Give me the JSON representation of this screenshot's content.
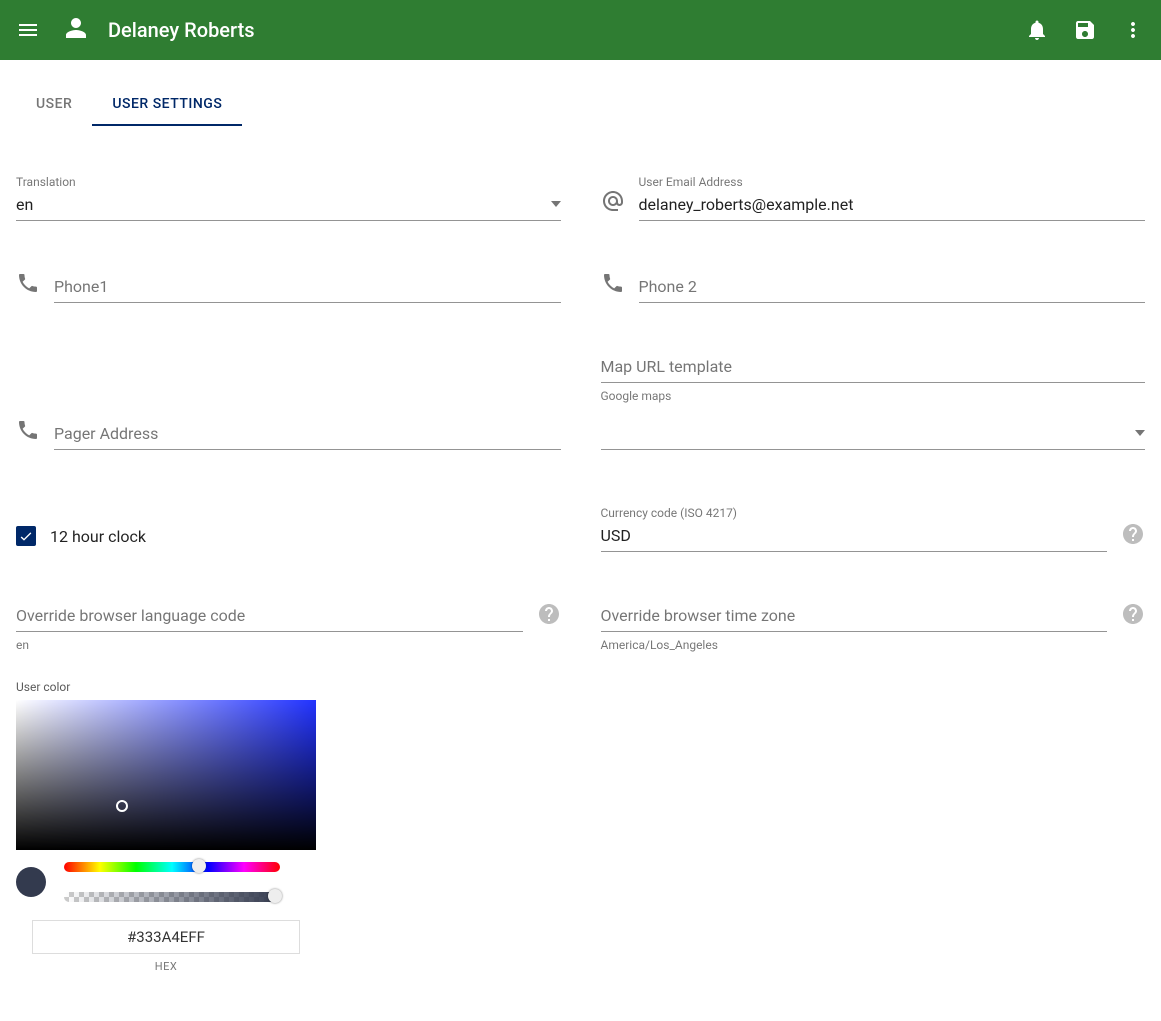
{
  "header": {
    "title": "Delaney Roberts"
  },
  "tabs": {
    "user": "USER",
    "user_settings": "USER SETTINGS"
  },
  "fields": {
    "translation": {
      "label": "Translation",
      "value": "en"
    },
    "email": {
      "label": "User Email Address",
      "value": "delaney_roberts@example.net"
    },
    "phone1": {
      "placeholder": "Phone1",
      "value": ""
    },
    "phone2": {
      "placeholder": "Phone 2",
      "value": ""
    },
    "pager": {
      "placeholder": "Pager Address",
      "value": ""
    },
    "mapurl": {
      "placeholder": "Map URL template",
      "value": "",
      "hint": "Google maps"
    },
    "mapurl_select": {
      "value": ""
    },
    "clock12": {
      "label": "12 hour clock",
      "checked": true
    },
    "currency": {
      "label": "Currency code (ISO 4217)",
      "value": "USD"
    },
    "lang_override": {
      "placeholder": "Override browser language code",
      "value": "",
      "hint": "en"
    },
    "tz_override": {
      "placeholder": "Override browser time zone",
      "value": "",
      "hint": "America/Los_Angeles"
    },
    "user_color": {
      "label": "User color",
      "hex": "#333A4EFF",
      "hex_caption": "HEX"
    }
  }
}
